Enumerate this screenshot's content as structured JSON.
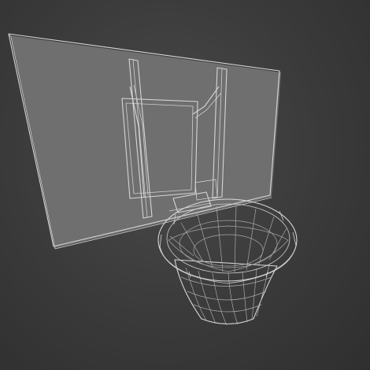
{
  "viewport": {
    "background_color": "#3d3d3d",
    "wire_color": "#d6d6d6",
    "surface_color": "#8a8a8a",
    "shade_color": "#6e6e6e"
  },
  "scene": {
    "objects": [
      "backboard",
      "bracket",
      "rim",
      "net"
    ]
  }
}
